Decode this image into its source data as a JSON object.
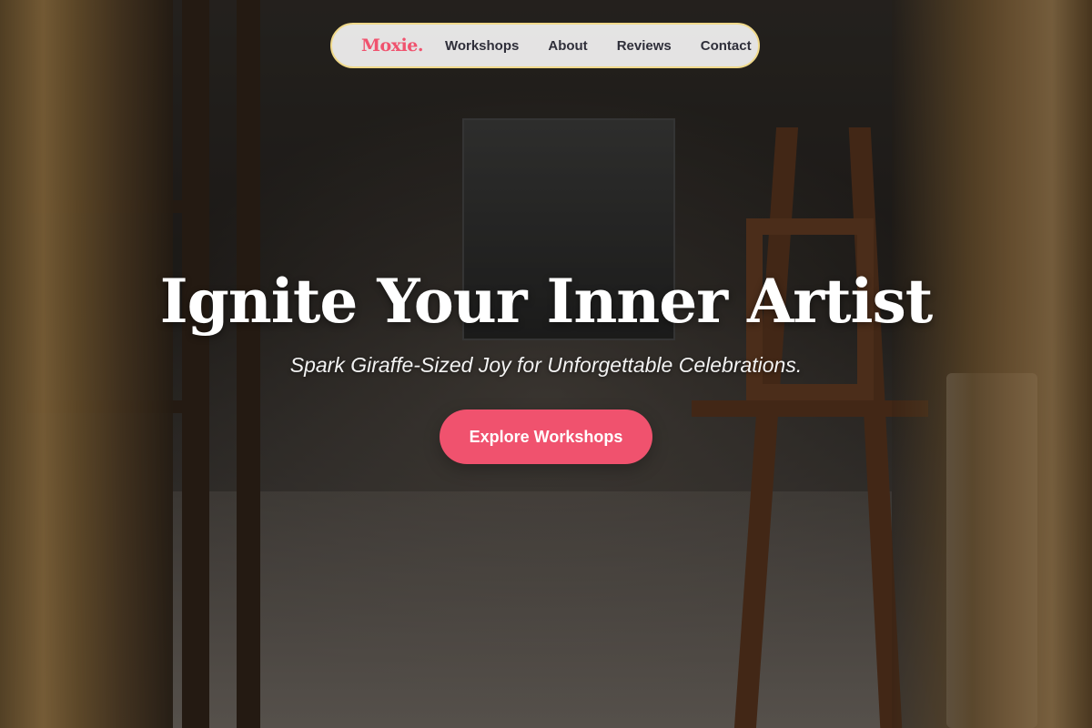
{
  "nav": {
    "logo": "Moxie.",
    "links": [
      "Workshops",
      "About",
      "Reviews",
      "Contact"
    ]
  },
  "hero": {
    "title": "Ignite Your Inner Artist",
    "subtitle": "Spark Giraffe-Sized Joy for Unforgettable Celebrations.",
    "cta_label": "Explore Workshops"
  },
  "colors": {
    "accent": "#f0526e",
    "nav_border": "#f0d98a",
    "nav_text": "#2f2f3a"
  }
}
